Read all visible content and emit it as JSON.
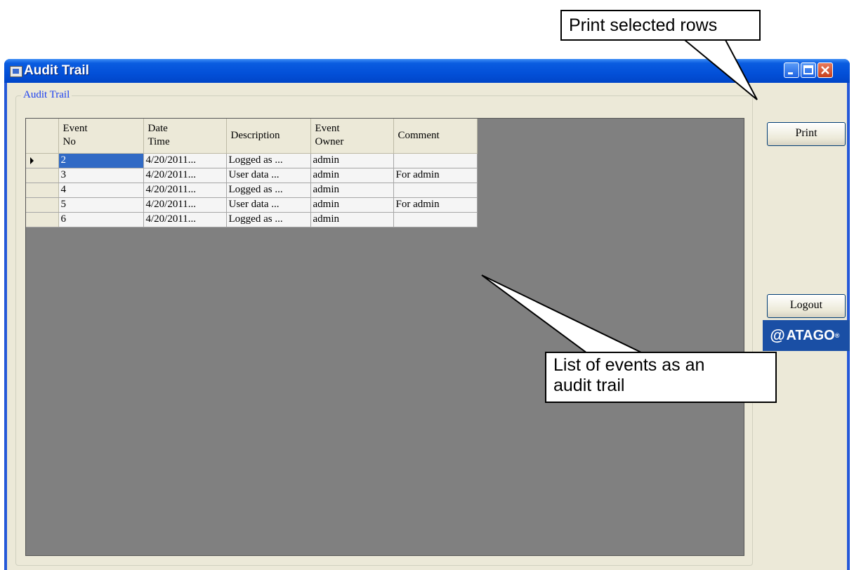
{
  "annotations": {
    "print_callout": "Print selected rows",
    "list_callout_line1": "List of events as an",
    "list_callout_line2": "audit trail"
  },
  "window": {
    "title": "Audit Trail",
    "group_label": "Audit Trail"
  },
  "grid": {
    "columns": [
      {
        "line1": "Event",
        "line2": "No"
      },
      {
        "line1": "Date",
        "line2": "Time"
      },
      {
        "line1": "Description",
        "line2": ""
      },
      {
        "line1": "Event",
        "line2": "Owner"
      },
      {
        "line1": "Comment",
        "line2": ""
      }
    ],
    "rows": [
      {
        "event_no": "2",
        "date_time": "4/20/2011...",
        "description": "Logged as ...",
        "owner": "admin",
        "comment": ""
      },
      {
        "event_no": "3",
        "date_time": "4/20/2011...",
        "description": "User data ...",
        "owner": "admin",
        "comment": "For admin"
      },
      {
        "event_no": "4",
        "date_time": "4/20/2011...",
        "description": "Logged as ...",
        "owner": "admin",
        "comment": ""
      },
      {
        "event_no": "5",
        "date_time": "4/20/2011...",
        "description": "User data ...",
        "owner": "admin",
        "comment": "For admin"
      },
      {
        "event_no": "6",
        "date_time": "4/20/2011...",
        "description": "Logged as ...",
        "owner": "admin",
        "comment": ""
      }
    ],
    "selected_row": 0
  },
  "buttons": {
    "print": "Print",
    "logout": "Logout"
  },
  "logo": {
    "text": "ATAGO",
    "icon": "atago-logo-icon"
  },
  "colors": {
    "titlebar": "#0350d8",
    "selection": "#316ac5",
    "grid_background": "#808080",
    "group_label": "#1a3ff0",
    "logo_bg": "#1a4fa5"
  }
}
